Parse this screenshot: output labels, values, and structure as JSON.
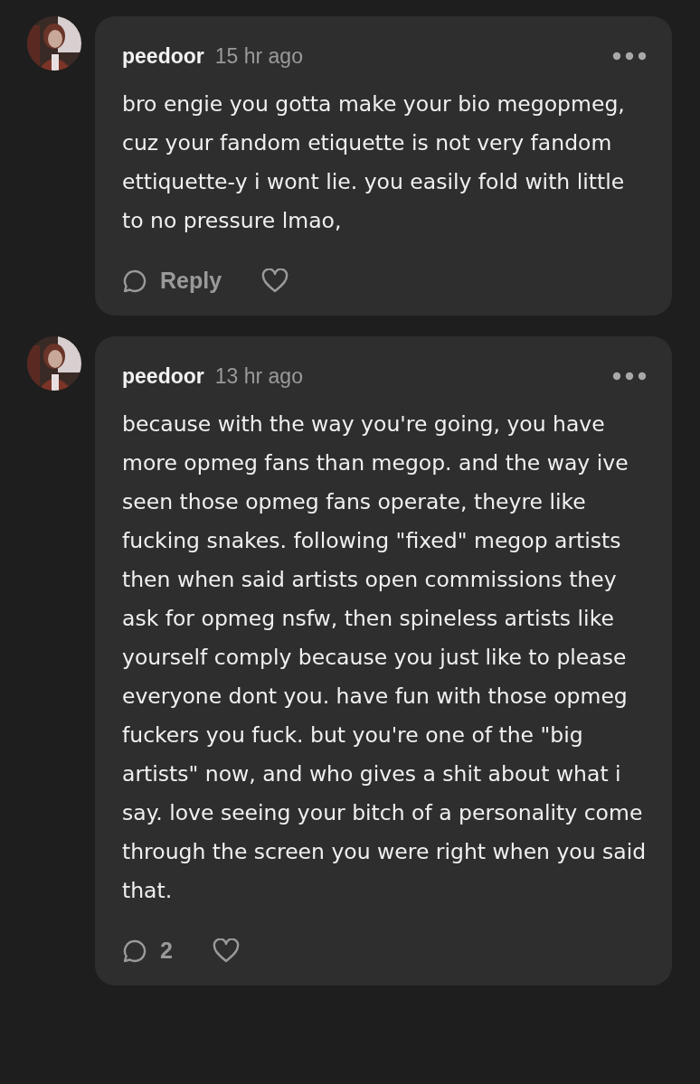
{
  "comments": [
    {
      "author": "peedoor",
      "time": "15 hr ago",
      "text": "bro engie you gotta make your bio megopmeg, cuz your fandom etiquette is not very fandom ettiquette-y i wont lie. you easily fold with little to no pressure lmao,",
      "reply": "Reply"
    },
    {
      "author": "peedoor",
      "time": "13 hr ago",
      "text": "because with the way you're going, you have more opmeg fans than megop. and the way ive seen those opmeg fans operate, theyre like fucking snakes. following \"fixed\" megop artists then when said artists open commissions they ask for opmeg nsfw, then spineless artists like yourself comply because you just like to please everyone dont you. have fun with those opmeg fuckers you fuck. but you're one of the \"big artists\" now, and who gives a shit about what i say. love seeing your bitch of a personality come through the screen you were right when you said that.",
      "reply": "2"
    }
  ]
}
